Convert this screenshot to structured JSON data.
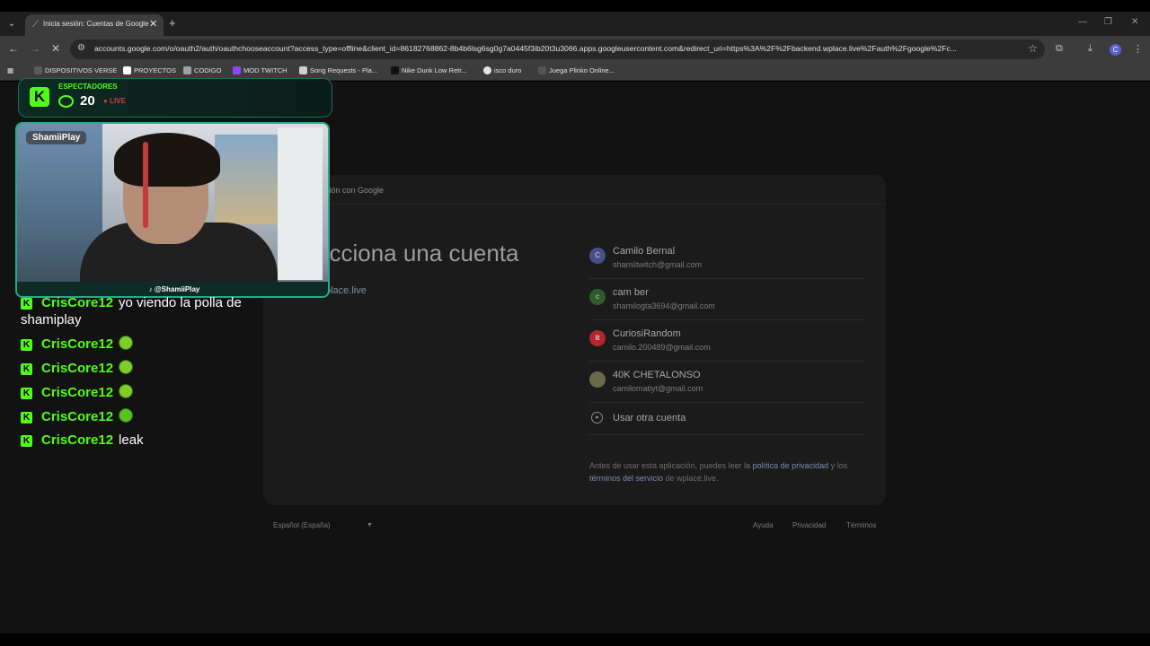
{
  "browser": {
    "tab_title": "Inicia sesión: Cuentas de Google",
    "url": "accounts.google.com/o/oauth2/auth/oauthchooseaccount?access_type=offline&client_id=86182768862-8b4b6lsg6sg0g7a0445f3ib20t3u3066.apps.googleusercontent.com&redirect_uri=https%3A%2F%2Fbackend.wplace.live%2Fauth%2Fgoogle%2Fc...",
    "profile_initial": "C",
    "bookmarks": [
      {
        "label": "DISPOSITIVOS VERSE",
        "color": "#5a5a5a"
      },
      {
        "label": "PROYECTOS",
        "color": "#ffffff"
      },
      {
        "label": "CODIGO",
        "color": "#9aa0a6"
      },
      {
        "label": "MOD TWITCH",
        "color": "#9146ff"
      },
      {
        "label": "Song Requests - Pla...",
        "color": "#cfcfcf"
      },
      {
        "label": "Nike Dunk Low Retr...",
        "color": "#111111"
      },
      {
        "label": "isco duro",
        "color": "#e3e3e3"
      },
      {
        "label": "Juega Plinko Online...",
        "color": "#555555"
      }
    ]
  },
  "signin": {
    "brand_text": "sión con Google",
    "title": "ecciona una cuenta",
    "subtitle": "place.live",
    "accounts": [
      {
        "name": "Camilo Bernal",
        "email": "shamiitwitch@gmail.com",
        "initial": "C",
        "color": "#4a4f8a"
      },
      {
        "name": "cam ber",
        "email": "shamilogta3694@gmail.com",
        "initial": "c",
        "color": "#2f5a2a"
      },
      {
        "name": "CuriosiRandom",
        "email": "camilo.200489@gmail.com",
        "initial": "it",
        "color": "#b3262e"
      },
      {
        "name": "40K CHETALONSO",
        "email": "camilomatiyt@gmail.com",
        "initial": "",
        "color": "#6a6a4a"
      }
    ],
    "other_account": "Usar otra cuenta",
    "legal_1": "Antes de usar esta aplicación, puedes leer la ",
    "legal_privacy": "política de privacidad",
    "legal_2": " y los ",
    "legal_terms": "términos del servicio",
    "legal_3": " de wplace.live.",
    "language": "Español (España)",
    "footer_links": [
      "Ayuda",
      "Privacidad",
      "Términos"
    ]
  },
  "stream": {
    "viewers_label": "ESPECTADORES",
    "viewers_count": "20",
    "live_label": "LIVE",
    "streamer_name": "ShamiiPlay",
    "handle": "@ShamiiPlay"
  },
  "chat": [
    {
      "user": "CrisCore12",
      "text": "yo viendo la polla de",
      "cont": "shamiplay",
      "emote": ""
    },
    {
      "user": "CrisCore12",
      "text": "",
      "emote": "sick"
    },
    {
      "user": "CrisCore12",
      "text": "",
      "emote": "sick"
    },
    {
      "user": "CrisCore12",
      "text": "",
      "emote": "sick"
    },
    {
      "user": "CrisCore12",
      "text": "",
      "emote": "grin"
    },
    {
      "user": "CrisCore12",
      "text": "leak",
      "emote": ""
    }
  ]
}
